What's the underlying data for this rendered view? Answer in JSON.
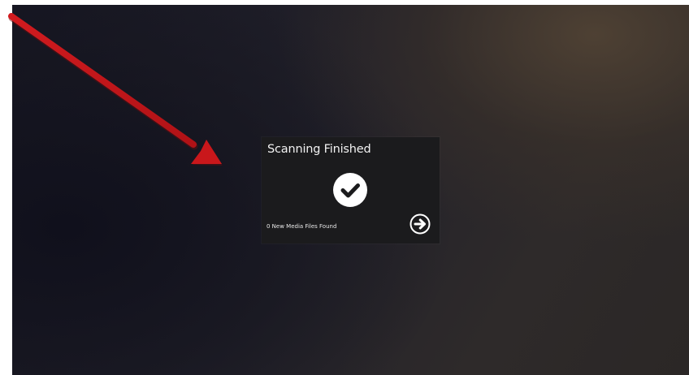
{
  "dialog": {
    "title": "Scanning Finished",
    "status": "0 New Media Files Found",
    "status_icon": "checkmark-circle-icon",
    "next_icon": "arrow-right-circle-icon"
  },
  "annotation": {
    "icon": "red-arrow-annotation",
    "color": "#c4161a"
  },
  "colors": {
    "dialog_background": "#1b1b1d",
    "text": "#f2f2f2",
    "check_fill": "#ffffff"
  }
}
